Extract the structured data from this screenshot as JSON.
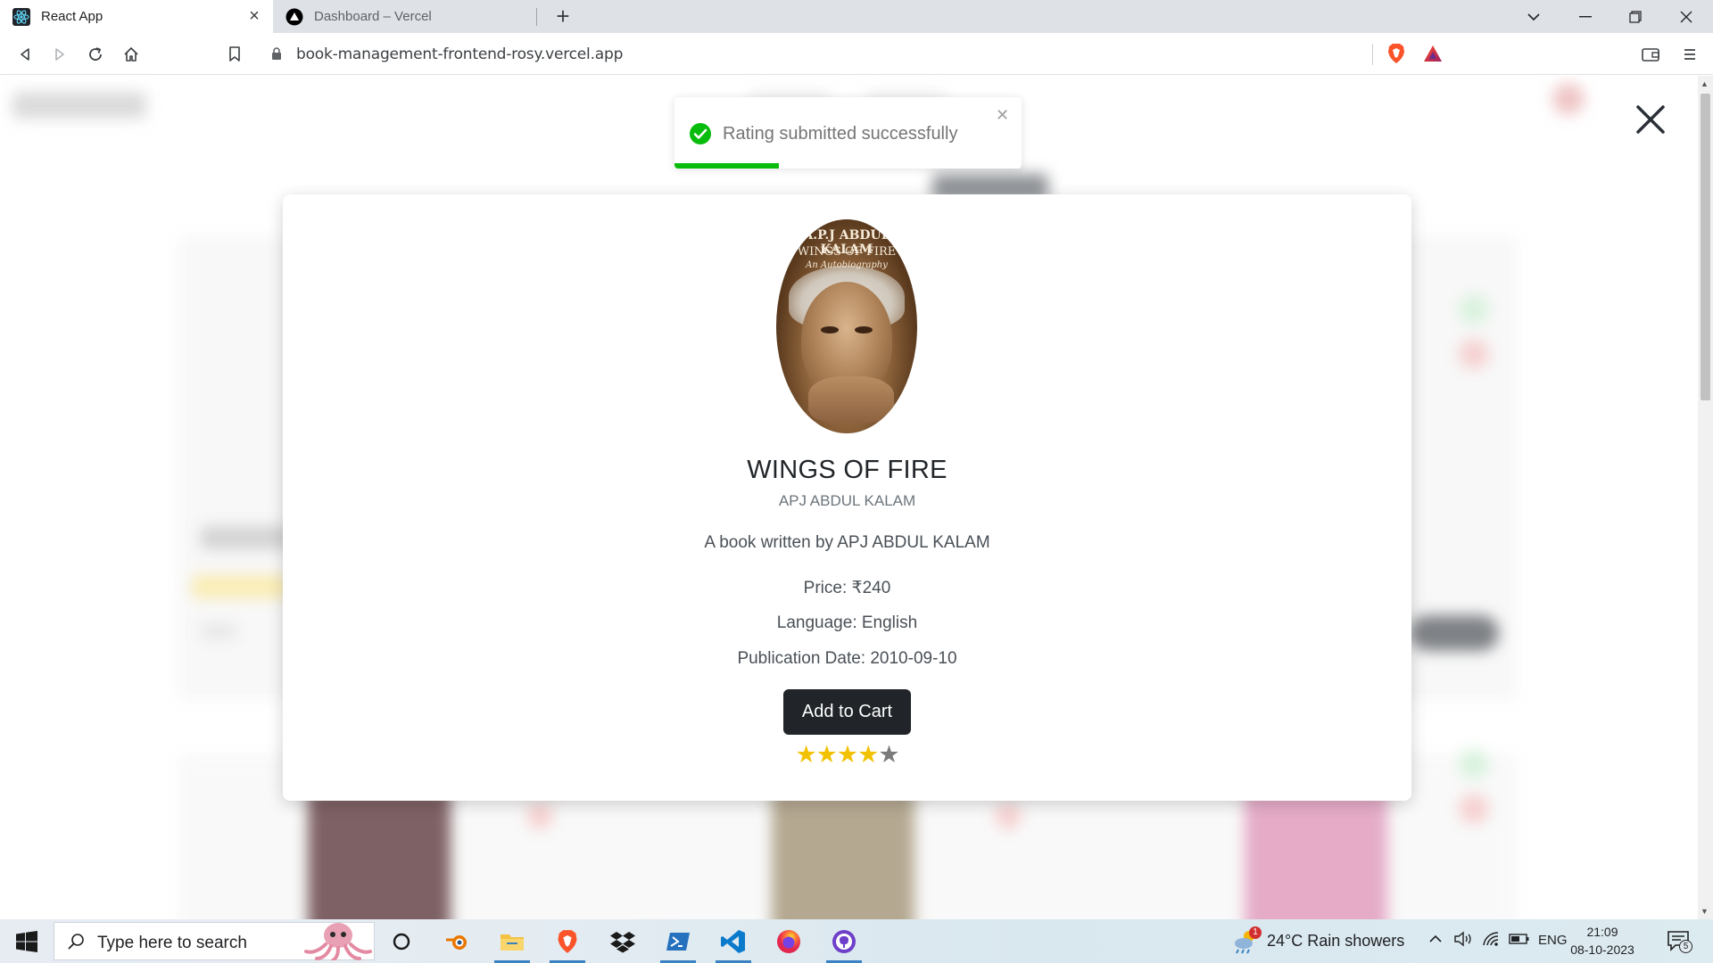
{
  "browser": {
    "tabs": [
      {
        "title": "React App",
        "active": true
      },
      {
        "title": "Dashboard – Vercel",
        "active": false
      }
    ],
    "url": "book-management-frontend-rosy.vercel.app"
  },
  "toast": {
    "message": "Rating submitted successfully",
    "progress": 0.3
  },
  "book_modal": {
    "cover_text": {
      "line1": "A.P.J ABDUL KALAM",
      "line2": "WINGS OF FIRE",
      "line3": "An Autobiography"
    },
    "title": "WINGS OF FIRE",
    "author": "APJ ABDUL KALAM",
    "description": "A book written by APJ ABDUL KALAM",
    "price": "Price: ₹240",
    "language": "Language: English",
    "publication_date": "Publication Date: 2010-09-10",
    "add_to_cart_label": "Add to Cart",
    "rating": 4,
    "rating_max": 5,
    "colors": {
      "star_on": "#f2c200",
      "star_off": "#7b7b7b",
      "button": "#212529"
    }
  },
  "taskbar": {
    "search_placeholder": "Type here to search",
    "weather": "24°C  Rain showers",
    "weather_badge": "1",
    "language": "ENG",
    "time": "21:09",
    "date": "08-10-2023",
    "notifications": "5",
    "apps": [
      "cortana-icon",
      "blender-icon",
      "file-explorer-icon",
      "brave-icon",
      "dropbox-icon",
      "powershell-icon",
      "vscode-icon",
      "firefox-icon",
      "github-desktop-icon"
    ]
  }
}
